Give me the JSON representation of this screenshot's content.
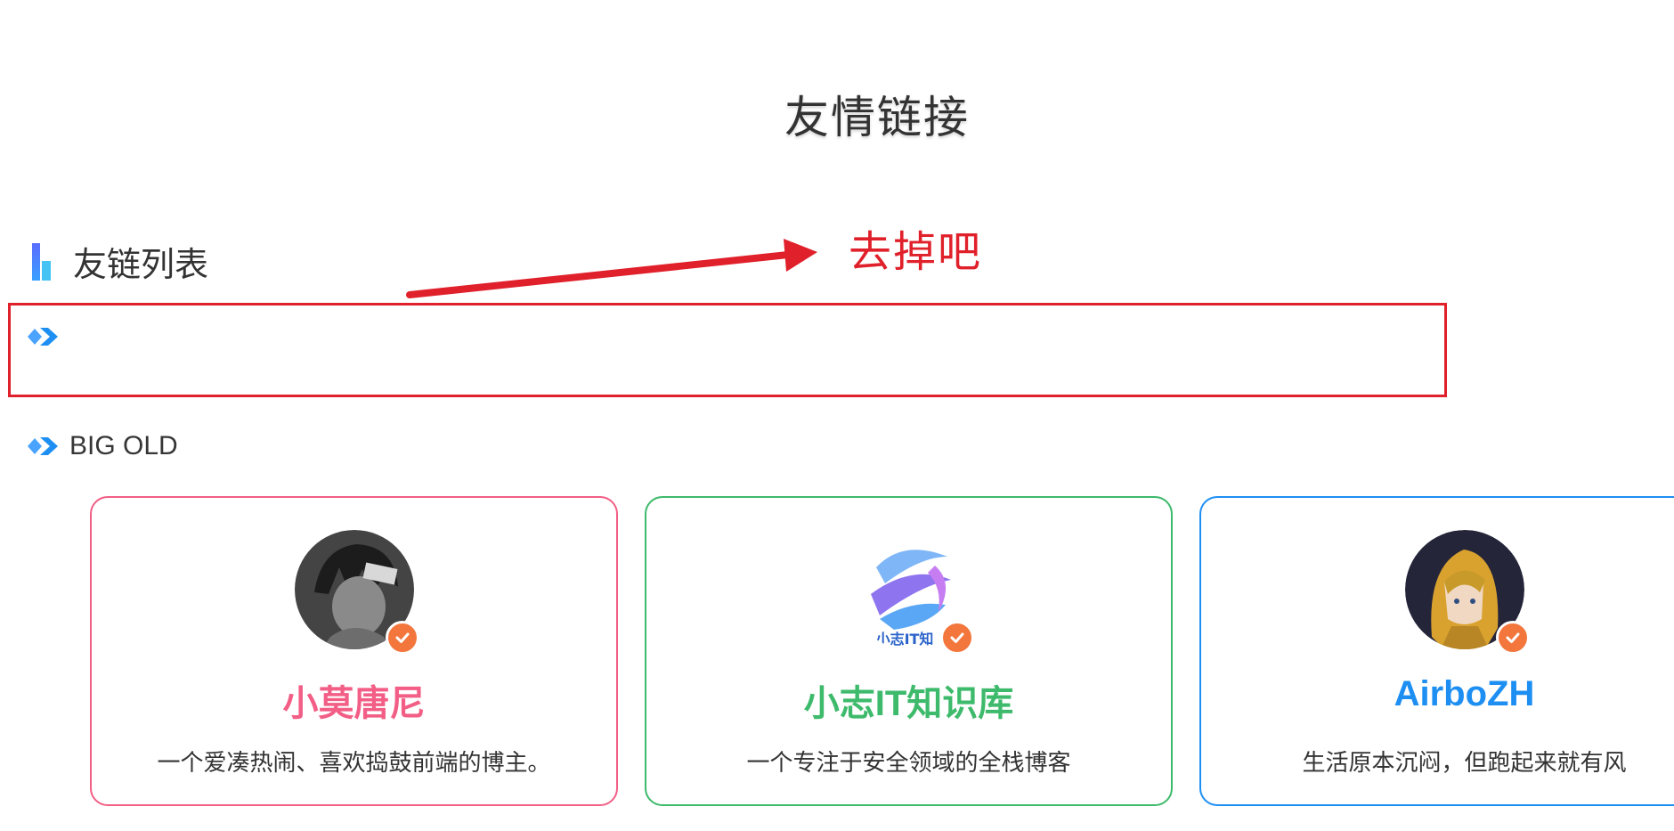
{
  "page": {
    "title": "友情链接"
  },
  "section": {
    "heading": "友链列表"
  },
  "annotation": {
    "text": "去掉吧",
    "color": "#e0202a"
  },
  "groups": [
    {
      "title": ""
    },
    {
      "title": "BIG OLD"
    }
  ],
  "cards": [
    {
      "name": "小莫唐尼",
      "description": "一个爱凑热闹、喜欢捣鼓前端的博主。",
      "color": "#f25e86",
      "avatar_icon": "avatar-dark-anime-portrait",
      "avatar_text": ""
    },
    {
      "name": "小志IT知识库",
      "description": "一个专注于安全领域的全栈博客",
      "color": "#3dba6b",
      "avatar_icon": "avatar-sphere-logo",
      "avatar_text": "小志IT知"
    },
    {
      "name": "AirboZH",
      "description": "生活原本沉闷，但跑起来就有风",
      "color": "#1e8ff2",
      "avatar_icon": "avatar-yellow-hood-portrait",
      "avatar_text": ""
    }
  ],
  "badge": {
    "icon": "check-badge-icon",
    "color": "#f3763c"
  }
}
